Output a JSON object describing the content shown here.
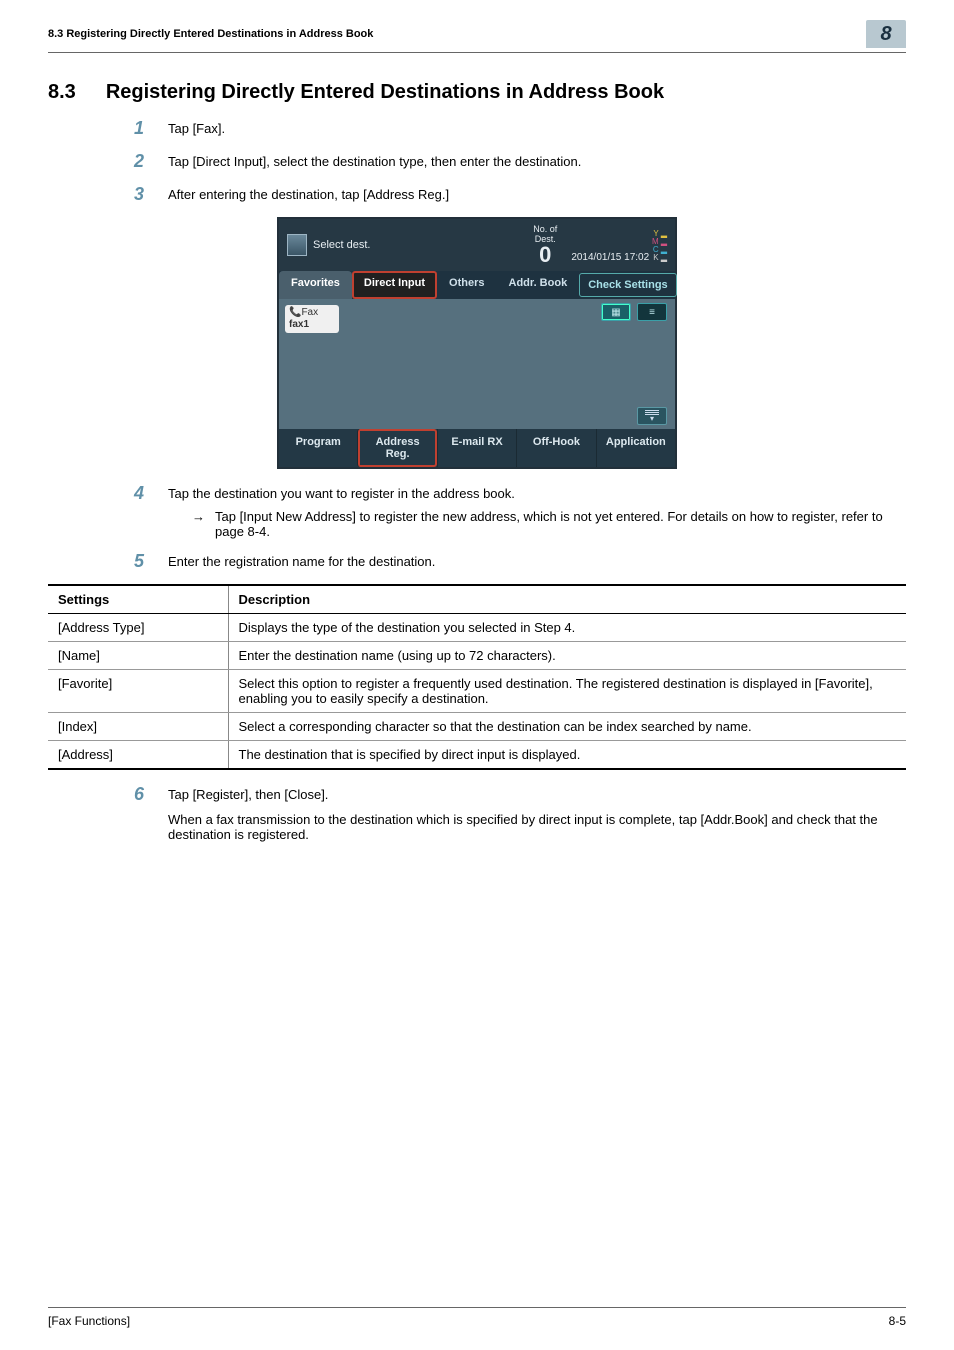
{
  "header": {
    "left": "8.3      Registering Directly Entered Destinations in Address Book",
    "chapter_num": "8"
  },
  "section": {
    "number": "8.3",
    "title": "Registering Directly Entered Destinations in Address Book"
  },
  "steps": {
    "s1": {
      "num": "1",
      "text": "Tap [Fax]."
    },
    "s2": {
      "num": "2",
      "text": "Tap [Direct Input], select the destination type, then enter the destination."
    },
    "s3": {
      "num": "3",
      "text": "After entering the destination, tap [Address Reg.]"
    },
    "s4": {
      "num": "4",
      "text": "Tap the destination you want to register in the address book.",
      "sub_arrow": "→",
      "sub_text": "Tap [Input New Address] to register the new address, which is not yet entered. For details on how to register, refer to page 8-4."
    },
    "s5": {
      "num": "5",
      "text": "Enter the registration name for the destination."
    },
    "s6": {
      "num": "6",
      "text": "Tap [Register], then [Close].",
      "extra": "When a fax transmission to the destination which is specified by direct input is complete, tap [Addr.Book] and check that the destination is registered."
    }
  },
  "shot": {
    "select_dest": "Select dest.",
    "dest_label": "No. of\nDest.",
    "dest_count": "0",
    "datetime": "2014/01/15 17:02",
    "tabs": {
      "favorites": "Favorites",
      "direct_input": "Direct Input",
      "others": "Others",
      "addr_book": "Addr. Book",
      "check_settings": "Check Settings"
    },
    "fax_card_icon": "Fax",
    "fax_card_label": "fax1",
    "bottom": {
      "program": "Program",
      "address_reg": "Address Reg.",
      "email_rx": "E-mail RX",
      "off_hook": "Off-Hook",
      "application": "Application"
    }
  },
  "table": {
    "head_settings": "Settings",
    "head_description": "Description",
    "rows": [
      {
        "s": "[Address Type]",
        "d": "Displays the type of the destination you selected in Step 4."
      },
      {
        "s": "[Name]",
        "d": "Enter the destination name (using up to 72 characters)."
      },
      {
        "s": "[Favorite]",
        "d": "Select this option to register a frequently used destination. The registered destination is displayed in [Favorite], enabling you to easily specify a destination."
      },
      {
        "s": "[Index]",
        "d": "Select a corresponding character so that the destination can be index searched by name."
      },
      {
        "s": "[Address]",
        "d": "The destination that is specified by direct input is displayed."
      }
    ]
  },
  "footer": {
    "left": "[Fax Functions]",
    "right": "8-5"
  }
}
